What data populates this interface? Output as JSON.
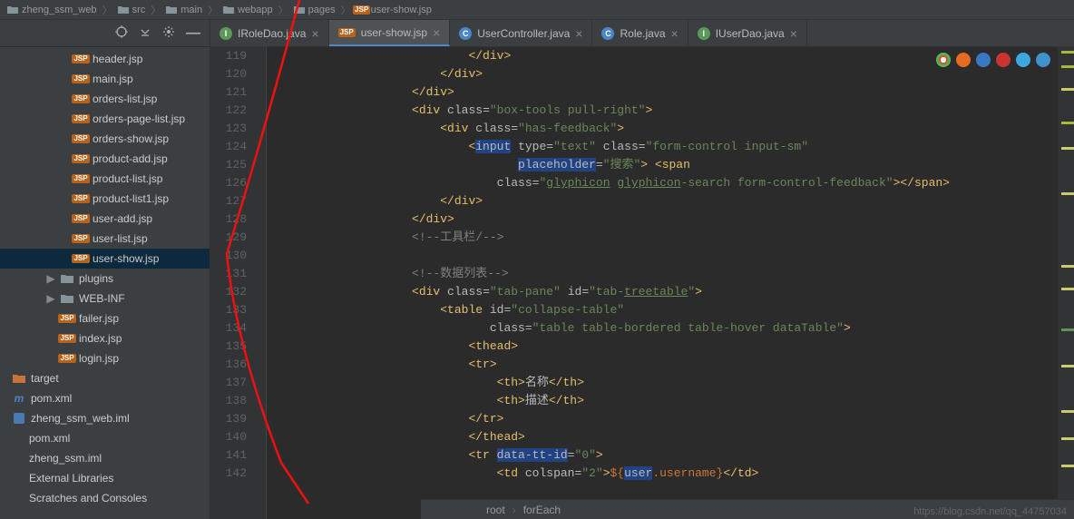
{
  "breadcrumb": {
    "items": [
      "zheng_ssm_web",
      "src",
      "main",
      "webapp",
      "pages",
      "user-show.jsp"
    ]
  },
  "sidebar": {
    "tree": [
      {
        "type": "jsp",
        "label": "header.jsp",
        "indent": 70
      },
      {
        "type": "jsp",
        "label": "main.jsp",
        "indent": 70
      },
      {
        "type": "jsp",
        "label": "orders-list.jsp",
        "indent": 70
      },
      {
        "type": "jsp",
        "label": "orders-page-list.jsp",
        "indent": 70
      },
      {
        "type": "jsp",
        "label": "orders-show.jsp",
        "indent": 70
      },
      {
        "type": "jsp",
        "label": "product-add.jsp",
        "indent": 70
      },
      {
        "type": "jsp",
        "label": "product-list.jsp",
        "indent": 70
      },
      {
        "type": "jsp",
        "label": "product-list1.jsp",
        "indent": 70
      },
      {
        "type": "jsp",
        "label": "user-add.jsp",
        "indent": 70
      },
      {
        "type": "jsp",
        "label": "user-list.jsp",
        "indent": 70
      },
      {
        "type": "jsp",
        "label": "user-show.jsp",
        "indent": 70,
        "selected": true
      },
      {
        "type": "folder",
        "label": "plugins",
        "indent": 40,
        "arrow": "▶"
      },
      {
        "type": "folder",
        "label": "WEB-INF",
        "indent": 40,
        "arrow": "▶"
      },
      {
        "type": "jsp",
        "label": "failer.jsp",
        "indent": 55
      },
      {
        "type": "jsp",
        "label": "index.jsp",
        "indent": 55
      },
      {
        "type": "jsp",
        "label": "login.jsp",
        "indent": 55
      },
      {
        "type": "folder-orange",
        "label": "target",
        "indent": 2
      },
      {
        "type": "pom",
        "label": "pom.xml",
        "indent": 2
      },
      {
        "type": "iml",
        "label": "zheng_ssm_web.iml",
        "indent": 2
      },
      {
        "type": "text",
        "label": "pom.xml",
        "indent": -18
      },
      {
        "type": "text",
        "label": "zheng_ssm.iml",
        "indent": -18
      },
      {
        "type": "text",
        "label": "External Libraries",
        "indent": -18
      },
      {
        "type": "text",
        "label": "Scratches and Consoles",
        "indent": -18
      }
    ]
  },
  "tabs": [
    {
      "icon": "i",
      "label": "IRoleDao.java",
      "active": false
    },
    {
      "icon": "jsp",
      "label": "user-show.jsp",
      "active": true
    },
    {
      "icon": "c",
      "label": "UserController.java",
      "active": false
    },
    {
      "icon": "c",
      "label": "Role.java",
      "active": false
    },
    {
      "icon": "i",
      "label": "IUserDao.java",
      "active": false
    }
  ],
  "gutter": {
    "start": 119,
    "end": 142
  },
  "code": {
    "lines": [
      {
        "indent": 28,
        "parts": [
          {
            "t": "tag",
            "v": "</div>"
          }
        ]
      },
      {
        "indent": 24,
        "parts": [
          {
            "t": "tag",
            "v": "</div>"
          }
        ]
      },
      {
        "indent": 20,
        "parts": [
          {
            "t": "tag",
            "v": "</div>"
          }
        ]
      },
      {
        "indent": 20,
        "parts": [
          {
            "t": "tag",
            "v": "<div "
          },
          {
            "t": "hl",
            "v": "class"
          },
          {
            "t": "attr",
            "v": "="
          },
          {
            "t": "string",
            "v": "\"box-tools pull-right\""
          },
          {
            "t": "tag",
            "v": ">"
          }
        ]
      },
      {
        "indent": 24,
        "parts": [
          {
            "t": "tag",
            "v": "<div "
          },
          {
            "t": "hl",
            "v": "class"
          },
          {
            "t": "attr",
            "v": "="
          },
          {
            "t": "string",
            "v": "\"has-feedback\""
          },
          {
            "t": "tag",
            "v": ">"
          }
        ]
      },
      {
        "indent": 28,
        "parts": [
          {
            "t": "tag",
            "v": "<"
          },
          {
            "t": "hlw",
            "v": "input"
          },
          {
            "t": "tag",
            "v": " "
          },
          {
            "t": "hl",
            "v": "type"
          },
          {
            "t": "attr",
            "v": "="
          },
          {
            "t": "string",
            "v": "\"text\""
          },
          {
            "t": "attr",
            "v": " "
          },
          {
            "t": "hl",
            "v": "class"
          },
          {
            "t": "attr",
            "v": "="
          },
          {
            "t": "string",
            "v": "\"form-control input-sm\""
          }
        ]
      },
      {
        "indent": 35,
        "parts": [
          {
            "t": "hlw",
            "v": "placeholder"
          },
          {
            "t": "attr",
            "v": "="
          },
          {
            "t": "string",
            "v": "\"搜索\""
          },
          {
            "t": "tag",
            "v": "> <span"
          }
        ]
      },
      {
        "indent": 32,
        "parts": [
          {
            "t": "hl",
            "v": "class"
          },
          {
            "t": "attr",
            "v": "="
          },
          {
            "t": "string",
            "v": "\""
          },
          {
            "t": "ul",
            "v": "glyphicon"
          },
          {
            "t": "string",
            "v": " "
          },
          {
            "t": "ul",
            "v": "glyphicon"
          },
          {
            "t": "string",
            "v": "-search form-control-feedback\""
          },
          {
            "t": "tag",
            "v": "></span>"
          }
        ]
      },
      {
        "indent": 24,
        "parts": [
          {
            "t": "tag",
            "v": "</div>"
          }
        ]
      },
      {
        "indent": 20,
        "parts": [
          {
            "t": "tag",
            "v": "</div>"
          }
        ]
      },
      {
        "indent": 20,
        "parts": [
          {
            "t": "comment",
            "v": "<!--工具栏/-->"
          }
        ]
      },
      {
        "indent": 0,
        "parts": []
      },
      {
        "indent": 20,
        "parts": [
          {
            "t": "comment",
            "v": "<!--数据列表-->"
          }
        ]
      },
      {
        "indent": 20,
        "parts": [
          {
            "t": "tag",
            "v": "<div "
          },
          {
            "t": "hl",
            "v": "class"
          },
          {
            "t": "attr",
            "v": "="
          },
          {
            "t": "string",
            "v": "\"tab-pane\""
          },
          {
            "t": "attr",
            "v": " "
          },
          {
            "t": "hl",
            "v": "id"
          },
          {
            "t": "attr",
            "v": "="
          },
          {
            "t": "string",
            "v": "\"tab-"
          },
          {
            "t": "ul",
            "v": "treetable"
          },
          {
            "t": "string",
            "v": "\""
          },
          {
            "t": "tag",
            "v": ">"
          }
        ]
      },
      {
        "indent": 24,
        "parts": [
          {
            "t": "tag",
            "v": "<table "
          },
          {
            "t": "hl",
            "v": "id"
          },
          {
            "t": "attr",
            "v": "="
          },
          {
            "t": "string",
            "v": "\"collapse-table\""
          }
        ]
      },
      {
        "indent": 31,
        "parts": [
          {
            "t": "hl",
            "v": "class"
          },
          {
            "t": "attr",
            "v": "="
          },
          {
            "t": "string",
            "v": "\"table table-bordered table-hover dataTable\""
          },
          {
            "t": "tag",
            "v": ">"
          }
        ]
      },
      {
        "indent": 28,
        "parts": [
          {
            "t": "tag",
            "v": "<thead>"
          }
        ]
      },
      {
        "indent": 28,
        "parts": [
          {
            "t": "tag",
            "v": "<tr>"
          }
        ]
      },
      {
        "indent": 32,
        "parts": [
          {
            "t": "tag",
            "v": "<th>"
          },
          {
            "t": "text",
            "v": "名称"
          },
          {
            "t": "tag",
            "v": "</th>"
          }
        ]
      },
      {
        "indent": 32,
        "parts": [
          {
            "t": "tag",
            "v": "<th>"
          },
          {
            "t": "text",
            "v": "描述"
          },
          {
            "t": "tag",
            "v": "</th>"
          }
        ]
      },
      {
        "indent": 28,
        "parts": [
          {
            "t": "tag",
            "v": "</tr>"
          }
        ]
      },
      {
        "indent": 28,
        "parts": [
          {
            "t": "tag",
            "v": "</thead>"
          }
        ]
      },
      {
        "indent": 28,
        "parts": [
          {
            "t": "tag",
            "v": "<tr "
          },
          {
            "t": "hlw",
            "v": "data-tt-id"
          },
          {
            "t": "attr",
            "v": "="
          },
          {
            "t": "string",
            "v": "\"0\""
          },
          {
            "t": "tag",
            "v": ">"
          }
        ]
      },
      {
        "indent": 32,
        "parts": [
          {
            "t": "tag",
            "v": "<td "
          },
          {
            "t": "hl",
            "v": "colspan"
          },
          {
            "t": "attr",
            "v": "="
          },
          {
            "t": "string",
            "v": "\"2\""
          },
          {
            "t": "tag",
            "v": ">"
          },
          {
            "t": "el",
            "v": "${"
          },
          {
            "t": "hlw",
            "v": "user"
          },
          {
            "t": "el",
            "v": ".username}"
          },
          {
            "t": "tag",
            "v": "</td>"
          }
        ]
      }
    ]
  },
  "status": {
    "path1": "root",
    "path2": "forEach"
  },
  "watermark": "https://blog.csdn.net/qq_44757034",
  "chart_data": null
}
